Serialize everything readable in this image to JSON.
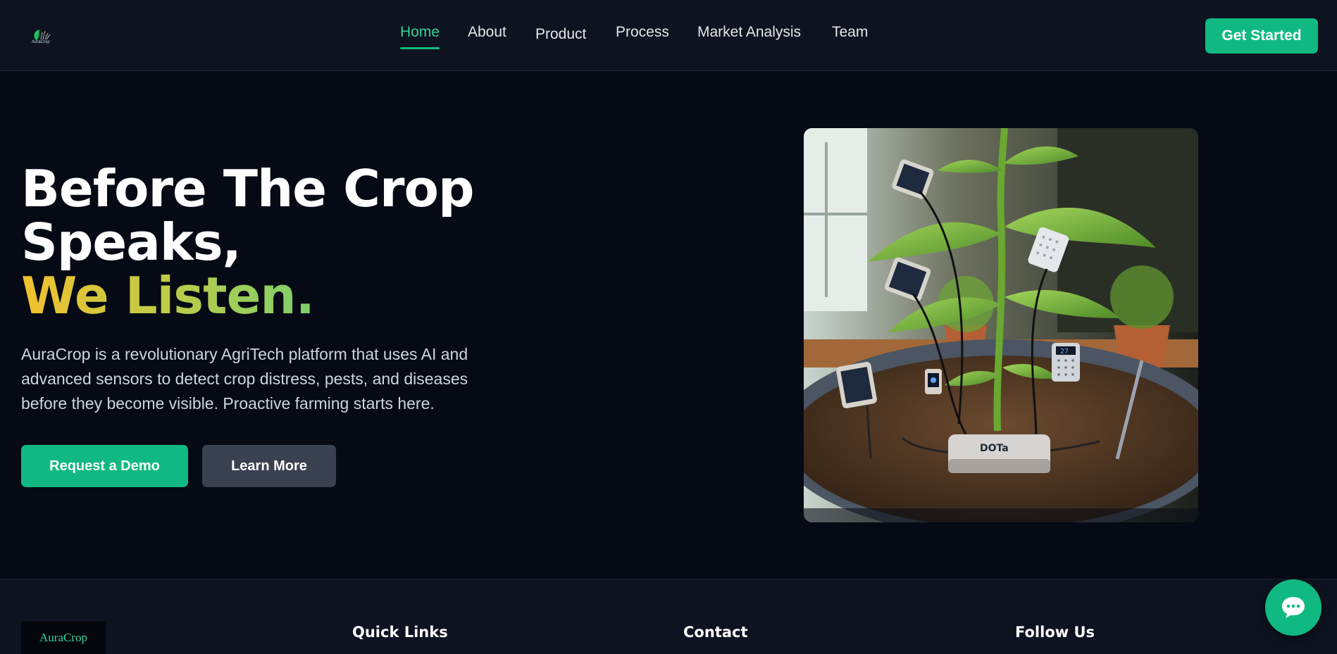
{
  "header": {
    "logo_text": "AuraCrop",
    "nav": [
      {
        "label": "Home",
        "active": true
      },
      {
        "label": "About"
      },
      {
        "label": "Product"
      },
      {
        "label": "Process"
      },
      {
        "label": "Market Analysis"
      },
      {
        "label": "Team"
      }
    ],
    "cta_label": "Get Started"
  },
  "hero": {
    "title_line1": "Before The Crop",
    "title_line2": "Speaks,",
    "title_line3": "We Listen.",
    "description": "AuraCrop is a revolutionary AgriTech platform that uses AI and advanced sensors to detect crop distress, pests, and diseases before they become visible. Proactive farming starts here.",
    "primary_button": "Request a Demo",
    "secondary_button": "Learn More",
    "device_label": "DOTa",
    "sensor_readout": "27"
  },
  "footer": {
    "brand": "AuraCrop",
    "headings": [
      "Quick Links",
      "Contact",
      "Follow Us"
    ]
  },
  "colors": {
    "accent": "#10b981",
    "background": "#060a14",
    "header_bg": "#0d1320",
    "secondary_button": "#3a4150",
    "gradient_start": "#f2c12e",
    "gradient_end": "#34d399"
  },
  "icons": {
    "chat": "chat-bubble-icon"
  }
}
